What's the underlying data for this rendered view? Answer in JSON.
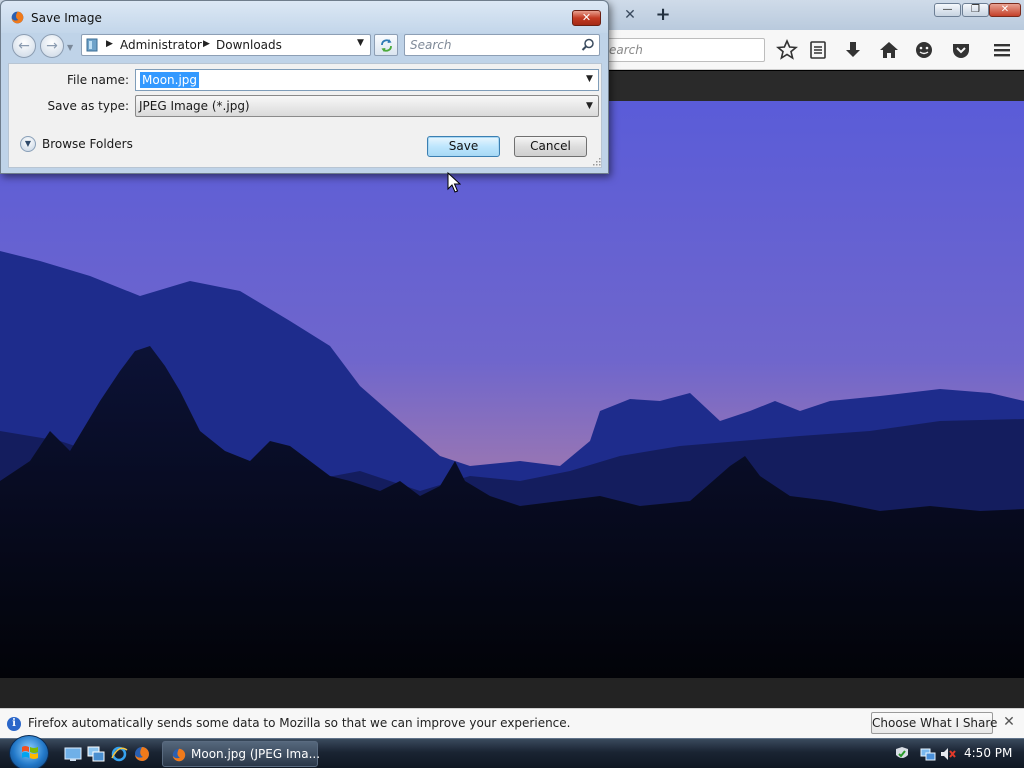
{
  "browser": {
    "tab_close_glyph": "✕",
    "new_tab_glyph": "+",
    "search_placeholder": "earch",
    "window_controls": {
      "minimize": "—",
      "maximize": "❐",
      "close": "✕"
    },
    "icons": [
      "bookmark-star-icon",
      "reading-list-icon",
      "downloads-icon",
      "home-icon",
      "hello-icon",
      "pocket-icon",
      "menu-icon"
    ]
  },
  "dialog": {
    "title": "Save Image",
    "close_glyph": "✕",
    "breadcrumb": [
      "Administrator",
      "Downloads"
    ],
    "search_placeholder": "Search",
    "file_name_label": "File name:",
    "file_name_value": "Moon.jpg",
    "save_as_type_label": "Save as type:",
    "save_as_type_value": "JPEG Image (*.jpg)",
    "browse_folders_label": "Browse Folders",
    "save_button": "Save",
    "cancel_button": "Cancel"
  },
  "notification": {
    "icon_glyph": "i",
    "message": "Firefox automatically sends some data to Mozilla so that we can improve your experience.",
    "button": "Choose What I Share",
    "close_glyph": "✕"
  },
  "taskbar": {
    "task_label": "Moon.jpg (JPEG Ima...",
    "clock": "4:50 PM"
  },
  "colors": {
    "sky_top": "#5c5ed6",
    "sky_horizon": "#8a6fb8",
    "mountains": "#1d2a8a",
    "selection": "#3399ff",
    "notif_icon": "#2a66c9"
  }
}
